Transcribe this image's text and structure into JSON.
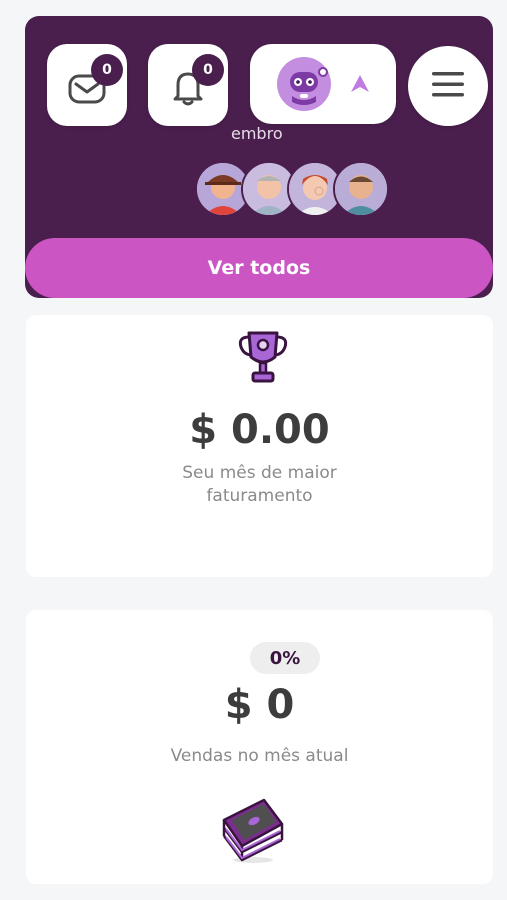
{
  "header": {
    "messages_badge": "0",
    "notifications_badge": "0",
    "members_label": "embro",
    "view_all_label": "Ver todos"
  },
  "best_month": {
    "value": "$ 0.00",
    "caption_line1": "Seu mês de maior",
    "caption_line2": "faturamento"
  },
  "current_month": {
    "percent": "0%",
    "value": "$ 0",
    "caption": "Vendas no mês atual"
  },
  "colors": {
    "header_bg": "#4a1f4e",
    "accent": "#cc55c4",
    "page_bg": "#f5f6f8"
  }
}
